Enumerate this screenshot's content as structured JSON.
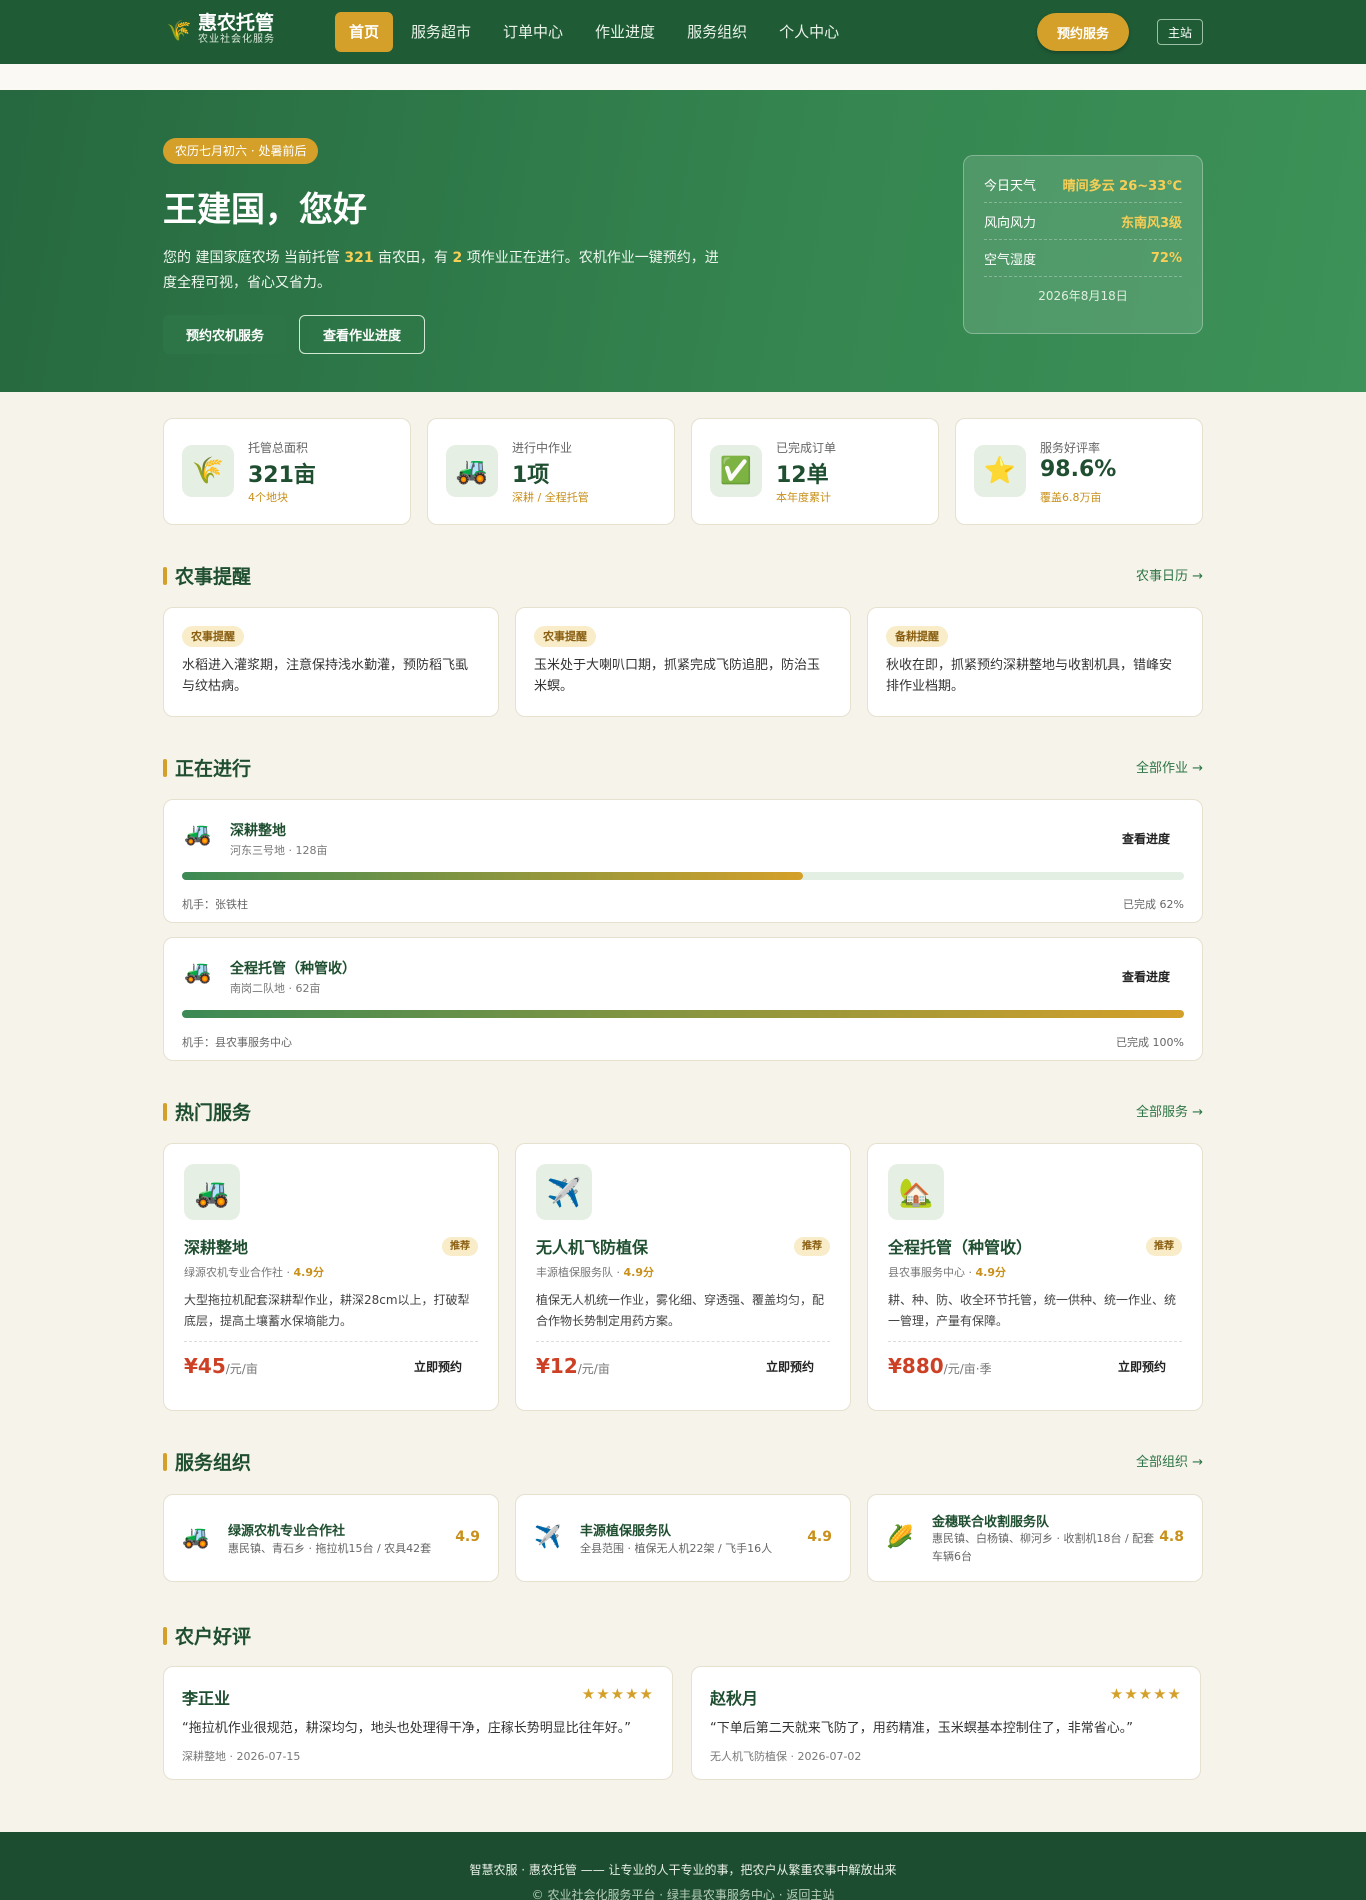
{
  "brand": {
    "name": "惠农托管",
    "tagline": "农业社会化服务"
  },
  "nav": {
    "items": [
      "首页",
      "服务超市",
      "订单中心",
      "作业进度",
      "服务组织",
      "个人中心"
    ],
    "active": 0,
    "book": "预约服务",
    "home": "主站"
  },
  "hero": {
    "tag": "农历七月初六 · 处暑前后",
    "greeting": "王建国，您好",
    "intro": {
      "a": "您的 建国家庭农场 当前托管 ",
      "area": "321",
      "b": " 亩农田，有 ",
      "jobs": "2",
      "c": " 项作业正在进行。农机作业一键预约，进度全程可视，省心又省力。"
    },
    "btn_primary": "预约农机服务",
    "btn_secondary": "查看作业进度",
    "weather": [
      {
        "k": "今日天气",
        "v": "晴间多云 26~33℃"
      },
      {
        "k": "风向风力",
        "v": "东南风3级"
      },
      {
        "k": "空气湿度",
        "v": "72%"
      }
    ],
    "date": "2026年8月18日"
  },
  "stats": [
    {
      "icon": "grain-icon",
      "glyph": "🌾",
      "label": "托管总面积",
      "value": "321亩",
      "sub": "4个地块"
    },
    {
      "icon": "tractor-icon",
      "glyph": "🚜",
      "label": "进行中作业",
      "value": "1项",
      "sub": "深耕 / 全程托管"
    },
    {
      "icon": "check-icon",
      "glyph": "✅",
      "label": "已完成订单",
      "value": "12单",
      "sub": "本年度累计"
    },
    {
      "icon": "star-icon",
      "glyph": "⭐",
      "label": "服务好评率",
      "value": "98.6%",
      "sub": "覆盖6.8万亩"
    }
  ],
  "reminders": {
    "title": "农事提醒",
    "more": "农事日历 →",
    "items": [
      {
        "badge": "农事提醒",
        "text": "水稻进入灌浆期，注意保持浅水勤灌，预防稻飞虱与纹枯病。"
      },
      {
        "badge": "农事提醒",
        "text": "玉米处于大喇叭口期，抓紧完成飞防追肥，防治玉米螟。"
      },
      {
        "badge": "备耕提醒",
        "text": "秋收在即，抓紧预约深耕整地与收割机具，错峰安排作业档期。"
      }
    ]
  },
  "jobs": {
    "title": "正在进行",
    "more": "全部作业 →",
    "items": [
      {
        "name": "深耕整地",
        "meta": "河东三号地 · 128亩",
        "link": "查看进度",
        "operator": "机手：张铁柱",
        "progress_text": "已完成 62%",
        "progress": 0.62
      },
      {
        "name": "全程托管（种管收）",
        "meta": "南岗二队地 · 62亩",
        "link": "查看进度",
        "operator": "机手：县农事服务中心",
        "progress_text": "已完成 100%",
        "progress": 1.0
      }
    ]
  },
  "services": {
    "title": "热门服务",
    "more": "全部服务 →",
    "items": [
      {
        "icon": "tractor-icon",
        "glyph": "🚜",
        "name": "深耕整地",
        "tag": "推荐",
        "provider": "绿源农机专业合作社 · ",
        "rating": "4.9分",
        "desc": "大型拖拉机配套深耕犁作业，耕深28cm以上，打破犁底层，提高土壤蓄水保墒能力。",
        "price": "¥45",
        "unit": "/元/亩",
        "btn": "立即预约"
      },
      {
        "icon": "drone-icon",
        "glyph": "✈️",
        "name": "无人机飞防植保",
        "tag": "推荐",
        "provider": "丰源植保服务队 · ",
        "rating": "4.9分",
        "desc": "植保无人机统一作业，雾化细、穿透强、覆盖均匀，配合作物长势制定用药方案。",
        "price": "¥12",
        "unit": "/元/亩",
        "btn": "立即预约"
      },
      {
        "icon": "farmhouse-icon",
        "glyph": "🏡",
        "name": "全程托管（种管收）",
        "tag": "推荐",
        "provider": "县农事服务中心 · ",
        "rating": "4.9分",
        "desc": "耕、种、防、收全环节托管，统一供种、统一作业、统一管理，产量有保障。",
        "price": "¥880",
        "unit": "/元/亩·季",
        "btn": "立即预约"
      }
    ]
  },
  "orgs": {
    "title": "服务组织",
    "more": "全部组织 →",
    "items": [
      {
        "icon": "tractor-icon",
        "glyph": "🚜",
        "name": "绿源农机专业合作社",
        "meta": "惠民镇、青石乡 · 拖拉机15台 / 农具42套",
        "rating": "4.9"
      },
      {
        "icon": "drone-icon",
        "glyph": "✈️",
        "name": "丰源植保服务队",
        "meta": "全县范围 · 植保无人机22架 / 飞手16人",
        "rating": "4.9"
      },
      {
        "icon": "corn-icon",
        "glyph": "🌽",
        "name": "金穗联合收割服务队",
        "meta": "惠民镇、白杨镇、柳河乡 · 收割机18台 / 配套车辆6台",
        "rating": "4.8"
      }
    ]
  },
  "reviews": {
    "title": "农户好评",
    "items": [
      {
        "name": "李正业",
        "stars": "★★★★★",
        "text": "“拖拉机作业很规范，耕深均匀，地头也处理得干净，庄稼长势明显比往年好。”",
        "meta": "深耕整地 · 2026-07-15"
      },
      {
        "name": "赵秋月",
        "stars": "★★★★★",
        "text": "“下单后第二天就来飞防了，用药精准，玉米螟基本控制住了，非常省心。”",
        "meta": "无人机飞防植保 · 2026-07-02"
      }
    ]
  },
  "footer": {
    "line1": "智慧农服 · 惠农托管 —— 让专业的人干专业的事，把农户从繁重农事中解放出来",
    "line2": "© 农业社会化服务平台 · 绿丰县农事服务中心 · ",
    "link": "返回主站"
  },
  "colors": {
    "primary": "#1f5c36",
    "accent": "#d4a02a",
    "price": "#cc4125"
  }
}
